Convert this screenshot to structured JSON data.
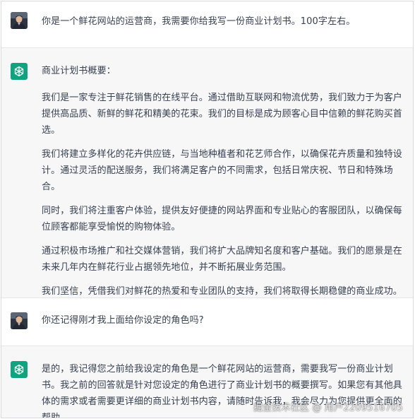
{
  "conversation": [
    {
      "role": "user",
      "paragraphs": [
        "你是一个鲜花网站的运营商，我需要你给我写一份商业计划书。100字左右。"
      ]
    },
    {
      "role": "assistant",
      "paragraphs": [
        "商业计划书概要：",
        "我们是一家专注于鲜花销售的在线平台。通过借助互联网和物流优势，我们致力于为客户提供高品质、新鲜的鲜花和精美的花束。我们的目标是成为顾客心目中信赖的鲜花购买首选。",
        "我们将建立多样化的花卉供应链，与当地种植者和花艺师合作，以确保花卉质量和独特设计。通过灵活的配送服务，我们将满足客户的不同需求，包括日常庆祝、节日和特殊场合。",
        "同时，我们将注重客户体验，提供友好便捷的网站界面和专业贴心的客服团队，以确保每位顾客都能享受愉悦的购物体验。",
        "通过积极市场推广和社交媒体营销，我们将扩大品牌知名度和客户基础。我们的愿景是在未来几年内在鲜花行业占据领先地位，并不断拓展业务范围。",
        "我们坚信，凭借我们对鲜花的热爱和专业团队的支持，我们将取得长期稳健的商业成功。"
      ]
    },
    {
      "role": "user",
      "paragraphs": [
        "你还记得刚才我上面给你设定的角色吗?"
      ]
    },
    {
      "role": "assistant",
      "paragraphs": [
        "是的，我记得您之前给我设定的角色是一个鲜花网站的运营商，需要我写一份商业计划书。我之前的回答就是针对您设定的角色进行了商业计划书的概要撰写。如果您有其他具体的需求或者需要更详细的商业计划书内容，请随时告诉我，我会尽力为您提供更全面的帮助。"
      ]
    }
  ],
  "watermark": "掘金技术社区 @ 用户2209516705",
  "colors": {
    "assistant_bg": "#f7f7f8",
    "gpt_green": "#10a37f",
    "text": "#374151"
  },
  "icons": {
    "user_avatar": "user-avatar-photo",
    "assistant_avatar": "openai-logo-icon"
  }
}
